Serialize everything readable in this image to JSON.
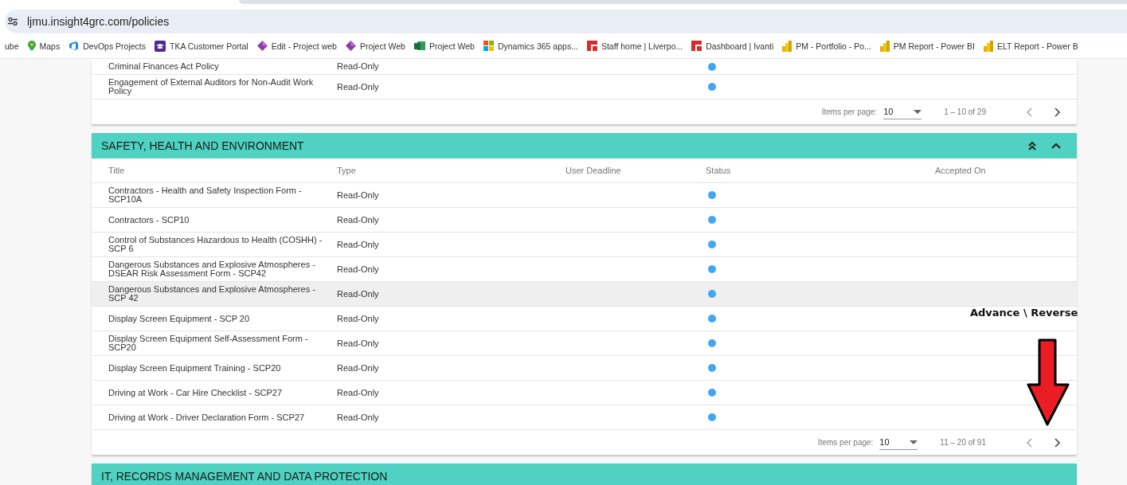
{
  "browser": {
    "url": "ljmu.insight4grc.com/policies",
    "bookmarks": [
      {
        "label": "ube",
        "kind": "none"
      },
      {
        "label": "Maps",
        "kind": "pin"
      },
      {
        "label": "DevOps Projects",
        "kind": "devops"
      },
      {
        "label": "TKA Customer Portal",
        "kind": "cap"
      },
      {
        "label": "Edit - Project web",
        "kind": "diamond"
      },
      {
        "label": "Project Web",
        "kind": "diamond"
      },
      {
        "label": "Project Web",
        "kind": "project"
      },
      {
        "label": "Dynamics 365 apps...",
        "kind": "grid"
      },
      {
        "label": "Staff home | Liverpo...",
        "kind": "logo"
      },
      {
        "label": "Dashboard | Ivanti",
        "kind": "logo"
      },
      {
        "label": "PM - Portfolio - Po...",
        "kind": "bars"
      },
      {
        "label": "PM Report - Power BI",
        "kind": "bars"
      },
      {
        "label": "ELT Report - Power B",
        "kind": "bars"
      }
    ]
  },
  "sections": [
    {
      "rows": [
        {
          "title": "Criminal Finances Act Policy",
          "type": "Read-Only",
          "color": "#42a5f5",
          "highlighted": false
        },
        {
          "title": "Engagement of External Auditors for Non-Audit Work Policy",
          "type": "Read-Only",
          "color": "#42a5f5",
          "highlighted": false
        }
      ],
      "paginator": {
        "label": "Items per page:",
        "page_size": "10",
        "range": "1 – 10 of 29"
      }
    },
    {
      "title": "SAFETY, HEALTH AND ENVIRONMENT",
      "expanded": true,
      "columns": [
        "Title",
        "Type",
        "User Deadline",
        "Status",
        "Accepted On"
      ],
      "rows": [
        {
          "title": "Contractors - Health and Safety Inspection Form - SCP10A",
          "type": "Read-Only",
          "color": "#42a5f5",
          "highlighted": false
        },
        {
          "title": "Contractors - SCP10",
          "type": "Read-Only",
          "color": "#42a5f5",
          "highlighted": false
        },
        {
          "title": "Control of Substances Hazardous to Health (COSHH) - SCP 6",
          "type": "Read-Only",
          "color": "#42a5f5",
          "highlighted": false
        },
        {
          "title": "Dangerous Substances and Explosive Atmospheres - DSEAR Risk Assessment Form - SCP42",
          "type": "Read-Only",
          "color": "#42a5f5",
          "highlighted": false
        },
        {
          "title": "Dangerous Substances and Explosive Atmospheres - SCP 42",
          "type": "Read-Only",
          "color": "#42a5f5",
          "highlighted": true
        },
        {
          "title": "Display Screen Equipment - SCP 20",
          "type": "Read-Only",
          "color": "#42a5f5",
          "highlighted": false
        },
        {
          "title": "Display Screen Equipment Self-Assessment Form - SCP20",
          "type": "Read-Only",
          "color": "#42a5f5",
          "highlighted": false
        },
        {
          "title": "Display Screen Equipment Training - SCP20",
          "type": "Read-Only",
          "color": "#42a5f5",
          "highlighted": false
        },
        {
          "title": "Driving at Work - Car Hire Checklist - SCP27",
          "type": "Read-Only",
          "color": "#42a5f5",
          "highlighted": false
        },
        {
          "title": "Driving at Work - Driver Declaration Form - SCP27",
          "type": "Read-Only",
          "color": "#42a5f5",
          "highlighted": false
        }
      ],
      "paginator": {
        "label": "Items per page:",
        "page_size": "10",
        "range": "11 – 20 of 91"
      }
    },
    {
      "title": "IT, RECORDS MANAGEMENT AND DATA PROTECTION"
    }
  ],
  "annotation": {
    "text": "Advance \\ Reverse"
  }
}
